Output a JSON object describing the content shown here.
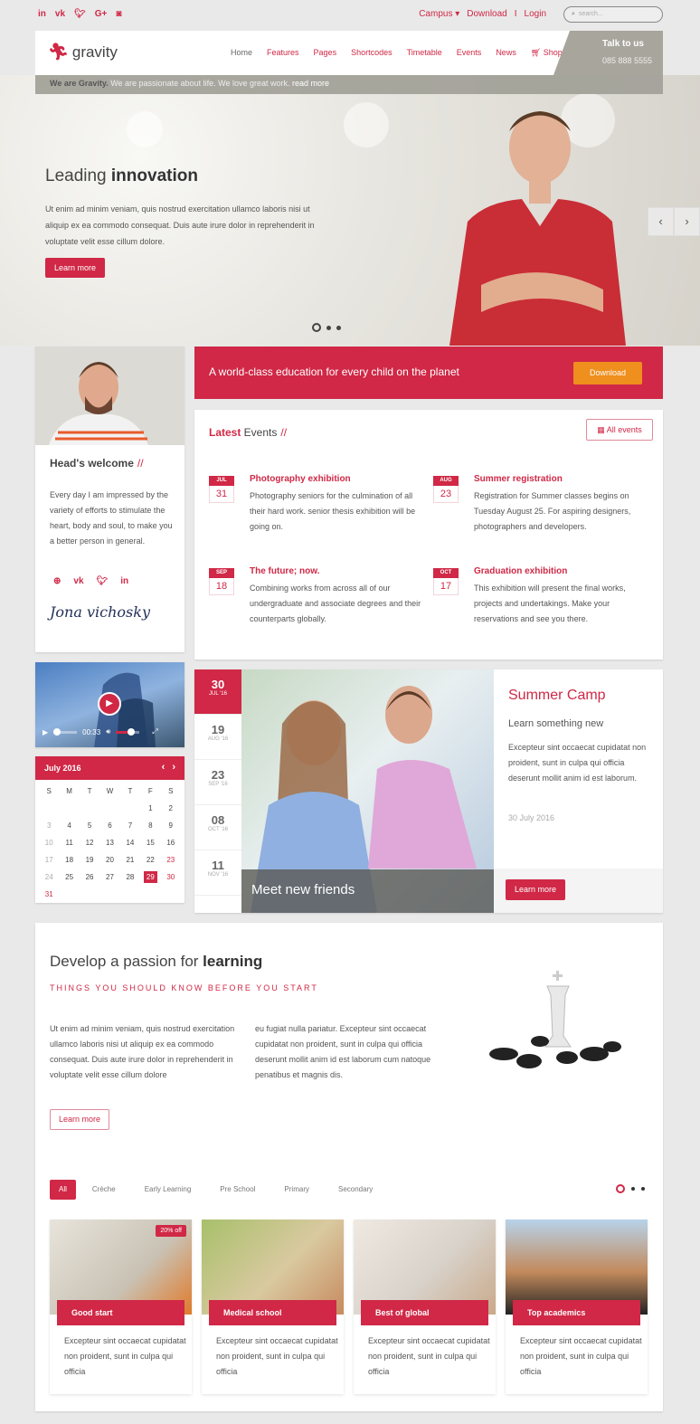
{
  "topbar": {
    "social": [
      "in",
      "vk",
      "tw",
      "G+",
      "ig"
    ],
    "links": {
      "campus": "Campus",
      "download": "Download",
      "sep": "I",
      "login": "Login"
    },
    "search_placeholder": "search..."
  },
  "header": {
    "logo": "gravity",
    "nav": [
      "Home",
      "Features",
      "Pages",
      "Shortcodes",
      "Timetable",
      "Events",
      "News",
      "Shop"
    ],
    "talk_title": "Talk to us",
    "talk_phone": "085 888 5555"
  },
  "strip": {
    "bold": "We are Gravity.",
    "text": " We are passionate about life. We love great work. ",
    "link": "read more"
  },
  "hero": {
    "title_light": "Leading ",
    "title_bold": "innovation",
    "text": "Ut enim ad minim veniam, quis nostrud exercitation ullamco laboris nisi ut aliquip ex ea commodo consequat. Duis aute irure dolor in reprehenderit in voluptate velit esse cillum dolore.",
    "button": "Learn more",
    "prev": "‹",
    "next": "›"
  },
  "head": {
    "title": "Head's welcome",
    "slash": "//",
    "text": "Every day I am impressed by the variety of efforts to stimulate the heart, body and soul, to make you a better person in general.",
    "social": [
      "⊕",
      "vk",
      "tw",
      "in"
    ],
    "signature": "Jona vichosky"
  },
  "banner": {
    "text": "A world-class education for every child on the planet",
    "button": "Download"
  },
  "events": {
    "title_red": "Latest",
    "title": " Events",
    "slash": "//",
    "all_label": "All events",
    "items": [
      {
        "month": "JUL",
        "day": "31",
        "title": "Photography exhibition",
        "text": "Photography seniors for the culmination of all their hard work. senior thesis exhibition will be going on."
      },
      {
        "month": "AUG",
        "day": "23",
        "title": "Summer registration",
        "text": "Registration for Summer classes begins on Tuesday August 25. For aspiring designers, photographers and developers."
      },
      {
        "month": "SEP",
        "day": "18",
        "title": "The future; now.",
        "text": "Combining works from across all of our undergraduate and associate degrees and their counterparts globally."
      },
      {
        "month": "OCT",
        "day": "17",
        "title": "Graduation exhibition",
        "text": "This exhibition will present the final works, projects and undertakings. Make your reservations and see you there."
      }
    ]
  },
  "video": {
    "time": "00:33",
    "progress": 0.05,
    "volume": 0.6
  },
  "calendar": {
    "month": "July 2016",
    "weekdays": [
      "S",
      "M",
      "T",
      "W",
      "T",
      "F",
      "S"
    ],
    "selected": "29",
    "days": [
      "",
      "",
      "",
      "",
      "",
      "1",
      "2",
      "3",
      "4",
      "5",
      "6",
      "7",
      "8",
      "9",
      "10",
      "11",
      "12",
      "13",
      "14",
      "15",
      "16",
      "17",
      "18",
      "19",
      "20",
      "21",
      "22",
      "23",
      "24",
      "25",
      "26",
      "27",
      "28",
      "29",
      "30",
      "31"
    ]
  },
  "feature": {
    "dates": [
      {
        "day": "30",
        "month": "JUL '16",
        "active": true
      },
      {
        "day": "19",
        "month": "AUG '16"
      },
      {
        "day": "23",
        "month": "SEP '16"
      },
      {
        "day": "08",
        "month": "OCT '16"
      },
      {
        "day": "11",
        "month": "NOV '16"
      }
    ],
    "caption": "Meet new friends",
    "title": "Summer Camp",
    "subtitle": "Learn something new",
    "text": "Excepteur sint occaecat cupidatat non proident, sunt in culpa qui officia deserunt mollit anim id est laborum.",
    "date": "30 July 2016",
    "button": "Learn more"
  },
  "learning": {
    "title_light": "Develop a passion for ",
    "title_bold": "learning",
    "subtitle": "THINGS YOU SHOULD KNOW BEFORE YOU START",
    "col1": "Ut enim ad minim veniam, quis nostrud exercitation ullamco laboris nisi ut aliquip ex ea commodo consequat. Duis aute irure dolor in reprehenderit in voluptate velit esse cillum dolore",
    "col2": "eu fugiat nulla pariatur. Excepteur sint occaecat cupidatat non proident, sunt in culpa qui officia deserunt mollit anim id est laborum cum natoque penatibus et magnis dis.",
    "button": "Learn more",
    "tabs": [
      "All",
      "Crèche",
      "Early Learning",
      "Pre School",
      "Primary",
      "Secondary"
    ],
    "courses": [
      {
        "title": "Good start",
        "badge": "20% off",
        "text": "Excepteur sint occaecat cupidatat non proident, sunt in culpa qui officia"
      },
      {
        "title": "Medical school",
        "text": "Excepteur sint occaecat cupidatat non proident, sunt in culpa qui officia"
      },
      {
        "title": "Best of global",
        "text": "Excepteur sint occaecat cupidatat non proident, sunt in culpa qui officia"
      },
      {
        "title": "Top academics",
        "text": "Excepteur sint occaecat cupidatat non proident, sunt in culpa qui officia"
      }
    ]
  },
  "colors": {
    "accent": "#d02846",
    "orange": "#ef8f1d",
    "gray": "#a8a59c"
  }
}
